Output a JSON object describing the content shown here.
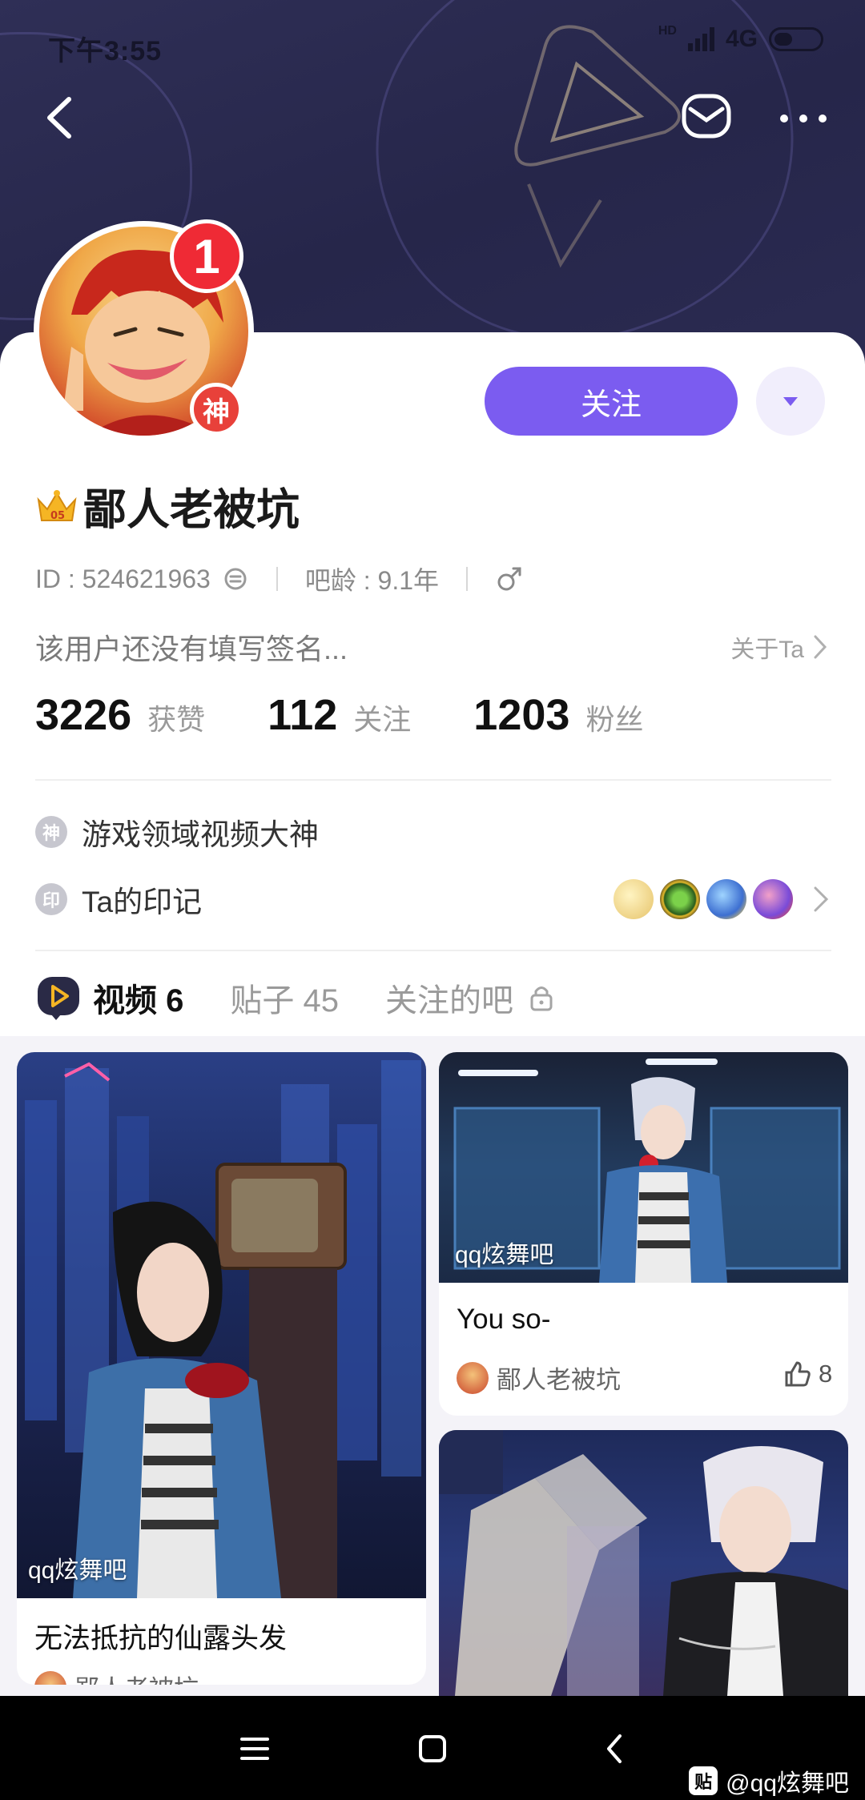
{
  "status_bar": {
    "time": "下午3:55",
    "hd": "HD",
    "network": "4G"
  },
  "header": {
    "icons": [
      "back-icon",
      "mail-icon",
      "more-icon"
    ]
  },
  "profile": {
    "badge_count": "1",
    "god_badge": "神",
    "follow_label": "关注",
    "username": "鄙人老被坑",
    "id_text": "ID : 524621963",
    "bar_age": "吧龄 : 9.1年",
    "gender": "male",
    "signature": "该用户还没有填写签名...",
    "about_label": "关于Ta"
  },
  "stats": [
    {
      "num": "3226",
      "label": "获赞"
    },
    {
      "num": "112",
      "label": "关注"
    },
    {
      "num": "1203",
      "label": "粉丝"
    }
  ],
  "info": {
    "title_icon": "神",
    "title_text": "游戏领域视频大神",
    "mark_icon": "印",
    "mark_text": "Ta的印记"
  },
  "tabs": {
    "video": "视频 6",
    "posts": "贴子 45",
    "followed": "关注的吧"
  },
  "videos": [
    {
      "watermark": "qq炫舞吧",
      "title": "无法抵抗的仙露头发",
      "author": "鄙人老被坑"
    },
    {
      "watermark": "qq炫舞吧",
      "title": "You so-",
      "author": "鄙人老被坑",
      "likes": "8"
    }
  ],
  "bottom_nav": {
    "watermark": "@qq炫舞吧",
    "logo": "贴"
  },
  "colors": {
    "accent": "#7b5cf0",
    "header_bg": "#2a2a50",
    "badge_red": "#ef2a35"
  }
}
